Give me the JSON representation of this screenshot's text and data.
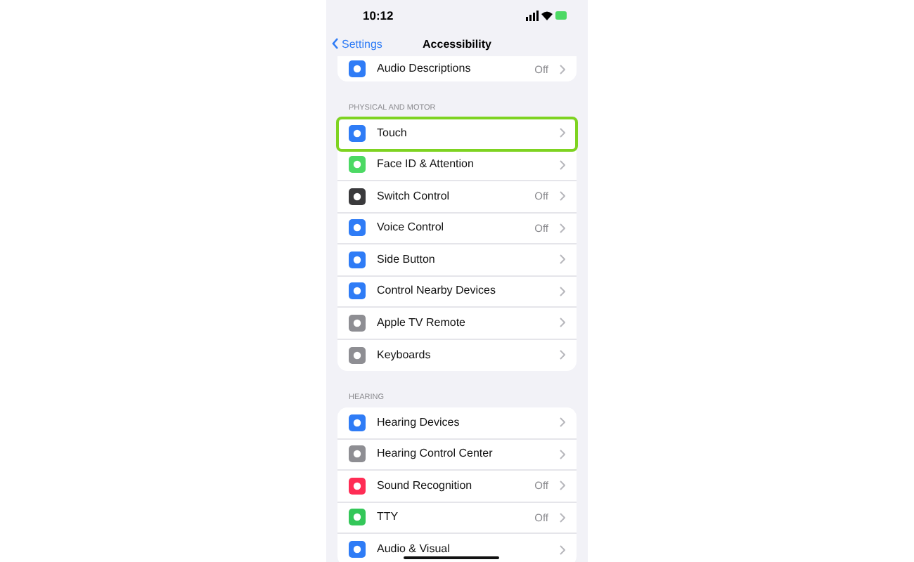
{
  "status_bar": {
    "time": "10:12"
  },
  "nav": {
    "back": "Settings",
    "title": "Accessibility"
  },
  "sections": [
    {
      "items": [
        {
          "label": "Audio Descriptions",
          "value": "Off",
          "color": "#2f7cf6",
          "highlighted": false
        }
      ]
    },
    {
      "header": "PHYSICAL AND MOTOR",
      "items": [
        {
          "label": "Touch",
          "color": "#2f7cf6",
          "highlighted": true
        },
        {
          "label": "Face ID & Attention",
          "color": "#4cd964",
          "highlighted": false
        },
        {
          "label": "Switch Control",
          "value": "Off",
          "color": "#3a3a3c",
          "highlighted": false
        },
        {
          "label": "Voice Control",
          "value": "Off",
          "color": "#2f7cf6",
          "highlighted": false
        },
        {
          "label": "Side Button",
          "color": "#2f7cf6",
          "highlighted": false
        },
        {
          "label": "Control Nearby Devices",
          "color": "#2f7cf6",
          "highlighted": false
        },
        {
          "label": "Apple TV Remote",
          "color": "#8e8e93",
          "highlighted": false
        },
        {
          "label": "Keyboards",
          "color": "#8e8e93",
          "highlighted": false
        }
      ]
    },
    {
      "header": "HEARING",
      "items": [
        {
          "label": "Hearing Devices",
          "color": "#2f7cf6",
          "highlighted": false
        },
        {
          "label": "Hearing Control Center",
          "color": "#8e8e93",
          "highlighted": false
        },
        {
          "label": "Sound Recognition",
          "value": "Off",
          "color": "#ff2d55",
          "highlighted": false
        },
        {
          "label": "TTY",
          "value": "Off",
          "color": "#34c759",
          "highlighted": false
        },
        {
          "label": "Audio & Visual",
          "color": "#2f7cf6",
          "highlighted": false
        }
      ]
    }
  ]
}
